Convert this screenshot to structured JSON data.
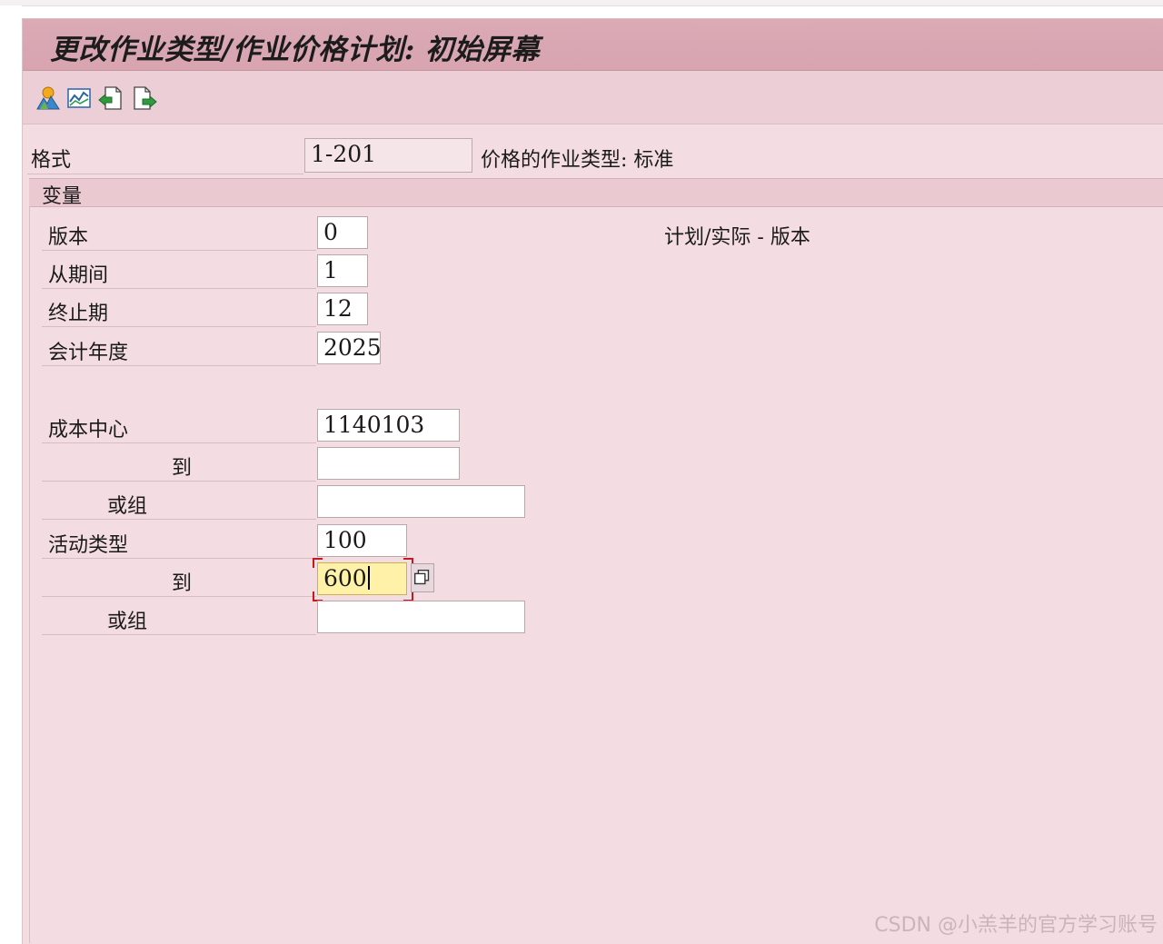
{
  "title": "更改作业类型/作业价格计划: 初始屏幕",
  "toolbar": {
    "icons": [
      "hierarchy-icon",
      "chart-line-icon",
      "document-back-icon",
      "document-forward-icon"
    ]
  },
  "format": {
    "label": "格式",
    "value": "1-201",
    "description": "价格的作业类型: 标准"
  },
  "group": {
    "title": "变量"
  },
  "fields": {
    "version": {
      "label": "版本",
      "value": "0",
      "description": "计划/实际 - 版本"
    },
    "from_period": {
      "label": "从期间",
      "value": "1"
    },
    "to_period": {
      "label": "终止期",
      "value": "12"
    },
    "fiscal_year": {
      "label": "会计年度",
      "value": "2025"
    },
    "cost_center": {
      "label": "成本中心",
      "value": "1140103"
    },
    "cost_center_to": {
      "label": "到",
      "value": ""
    },
    "cost_center_group": {
      "label": "或组",
      "value": ""
    },
    "activity_type": {
      "label": "活动类型",
      "value": "100"
    },
    "activity_type_to": {
      "label": "到",
      "value": "600"
    },
    "activity_type_group": {
      "label": "或组",
      "value": ""
    }
  },
  "watermark": "CSDN @小羔羊的官方学习账号"
}
